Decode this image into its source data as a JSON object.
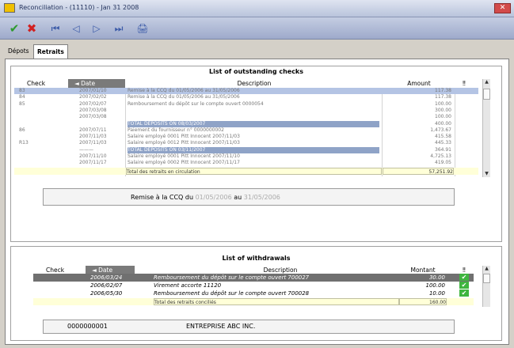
{
  "window": {
    "title": "Reconciliation - (11110) - Jan 31 2008"
  },
  "toolbar": {
    "icons": [
      "check-icon",
      "x-icon",
      "first-icon",
      "prev-icon",
      "next-icon",
      "last-icon",
      "print-icon"
    ],
    "glyphs": {
      "check": "✔",
      "x": "✖",
      "first": "⏮",
      "prev": "◁",
      "next": "▷",
      "last": "⏭",
      "print": "🖨"
    }
  },
  "tabs": [
    {
      "label": "Dépots",
      "active": false
    },
    {
      "label": "Retraits",
      "active": true
    }
  ],
  "checks": {
    "title": "List of outstanding checks",
    "columns": {
      "check": "Check",
      "date": "Date",
      "description": "Description",
      "amount": "Amount",
      "flag": "‼"
    },
    "rows": [
      {
        "check": "83",
        "date": "2007/01/10",
        "description": "Remise à la CCQ du 01/05/2006 au 31/05/2006",
        "amount": "117.38",
        "highlight": true
      },
      {
        "check": "84",
        "date": "2007/02/02",
        "description": "Remise à la CCQ du 01/05/2006 au 31/05/2006",
        "amount": "117.38",
        "highlight": false
      },
      {
        "check": "85",
        "date": "2007/02/07",
        "description": "Remboursement du dépôt sur le compte ouvert 0000054",
        "amount": "100.00",
        "highlight": false
      },
      {
        "check": "",
        "date": "2007/03/08",
        "description": "",
        "amount": "300.00",
        "highlight": false
      },
      {
        "check": "",
        "date": "2007/03/08",
        "description": "",
        "amount": "100.00",
        "highlight": false
      },
      {
        "check": "",
        "date": "",
        "description": "TOTAL DEPOSITS ON 08/03/2007",
        "amount": "400.00",
        "highlight": true
      },
      {
        "check": "86",
        "date": "2007/07/11",
        "description": "Paiement du fournisseur n° 0000000002",
        "amount": "1,473.67",
        "highlight": false
      },
      {
        "check": "",
        "date": "2007/11/03",
        "description": "Salaire employé 0001 Pitt Innocent 2007/11/03",
        "amount": "415.58",
        "highlight": false
      },
      {
        "check": "R13",
        "date": "2007/11/03",
        "description": "Salaire employé 0012 Pitt Innocent 2007/11/03",
        "amount": "445.33",
        "highlight": false
      },
      {
        "check": "",
        "date": "———",
        "description": "TOTAL DEPOSITS ON 03/11/2007",
        "amount": "364.91",
        "highlight": true
      },
      {
        "check": "",
        "date": "2007/11/10",
        "description": "Salaire employé 0001 Pitt Innocent 2007/11/10",
        "amount": "4,725.13",
        "highlight": false
      },
      {
        "check": "",
        "date": "2007/11/17",
        "description": "Salaire employé 0002 Pitt Innocent 2007/11/17",
        "amount": "419.05",
        "highlight": false
      }
    ],
    "total": {
      "label": "Total des retraits en circulation",
      "amount": "57,251.92"
    },
    "summary": {
      "prefix": "Remise à la CCQ du",
      "from": "01/05/2006",
      "middle": "au",
      "to": "31/05/2006"
    }
  },
  "withdrawals": {
    "title": "List of withdrawals",
    "columns": {
      "check": "Check",
      "date": "Date",
      "description": "Description",
      "amount": "Montant",
      "flag": "‼"
    },
    "rows": [
      {
        "check": "",
        "date": "2006/03/24",
        "description": "Remboursement du dépôt sur le compte ouvert 700027",
        "amount": "30.00",
        "selected": true
      },
      {
        "check": "",
        "date": "2006/02/07",
        "description": "Virement accorte 11120",
        "amount": "100.00",
        "selected": false
      },
      {
        "check": "",
        "date": "2006/05/30",
        "description": "Remboursement du dépôt sur le compte ouvert 700028",
        "amount": "10.00",
        "selected": false
      }
    ],
    "total": {
      "label": "Total des retraits conciliés",
      "amount": "160.00"
    },
    "footer": {
      "account": "0000000001",
      "company": "ENTREPRISE ABC INC."
    }
  },
  "colors": {
    "accent": "#8fa3c7",
    "check_green": "#3fb53f",
    "total_bg": "#ffffd8"
  }
}
